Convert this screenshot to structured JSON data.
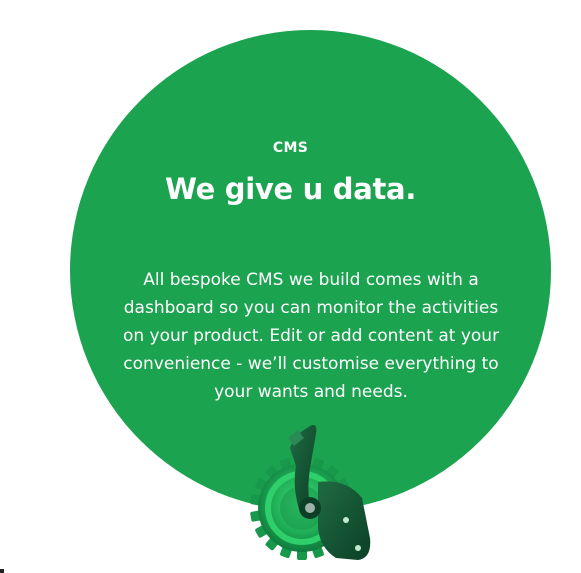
{
  "section": {
    "eyebrow": "CMS",
    "headline": "We give u data.",
    "body": "All bespoke CMS we build comes with a dashboard so you can monitor the activities on your product. Edit or add content at your convenience - we’ll customise everything to your wants and needs."
  },
  "colors": {
    "background": "#ffffff",
    "circle": "#1ba350",
    "text": "#ffffff",
    "gear_dark": "#0e6b3a",
    "gear_light": "#22c55e"
  },
  "illustration": {
    "icon": "gear-lever-icon"
  }
}
